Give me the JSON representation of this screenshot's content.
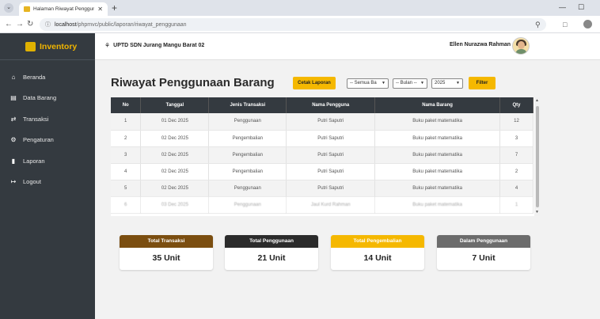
{
  "browser": {
    "tab_title": "Halaman Riwayat Penggunaan",
    "url_host": "localhost",
    "url_path": "/phpmvc/public/laporan/riwayat_penggunaan"
  },
  "sidebar": {
    "brand": "Inventory",
    "items": [
      {
        "label": "Beranda",
        "icon": "home-icon"
      },
      {
        "label": "Data Barang",
        "icon": "list-icon"
      },
      {
        "label": "Transaksi",
        "icon": "exchange-icon"
      },
      {
        "label": "Pengaturan",
        "icon": "gears-icon"
      },
      {
        "label": "Laporan",
        "icon": "file-icon"
      },
      {
        "label": "Logout",
        "icon": "logout-icon"
      }
    ]
  },
  "header": {
    "school": "UPTD SDN Jurang Mangu Barat 02",
    "user": "Ellen Nurazwa Rahman"
  },
  "page": {
    "title": "Riwayat Penggunaan Barang",
    "cetak_label": "Cetak Laporan",
    "filter_type": "-- Semua Ba",
    "filter_month": "-- Bulan --",
    "filter_year": "2025",
    "filter_label": "Filter"
  },
  "table": {
    "headers": [
      "No",
      "Tanggal",
      "Jenis Transaksi",
      "Nama Pengguna",
      "Nama Barang",
      "Qty"
    ],
    "rows": [
      [
        "1",
        "01 Dec 2025",
        "Penggunaan",
        "Putri Saputri",
        "Buku paket matematika",
        "12"
      ],
      [
        "2",
        "02 Dec 2025",
        "Pengembalian",
        "Putri Saputri",
        "Buku paket matematika",
        "3"
      ],
      [
        "3",
        "02 Dec 2025",
        "Pengembalian",
        "Putri Saputri",
        "Buku paket matematika",
        "7"
      ],
      [
        "4",
        "02 Dec 2025",
        "Pengembalian",
        "Putri Saputri",
        "Buku paket matematika",
        "2"
      ],
      [
        "5",
        "02 Dec 2025",
        "Penggunaan",
        "Putri Saputri",
        "Buku paket matematika",
        "4"
      ],
      [
        "6",
        "03 Dec 2025",
        "Penggunaan",
        "Jaul Kurd Rahman",
        "Buku paket matematika",
        "1"
      ]
    ]
  },
  "summary": [
    {
      "label": "Total Transaksi",
      "value": "35 Unit",
      "color": "#7b4e10"
    },
    {
      "label": "Total Penggunaan",
      "value": "21 Unit",
      "color": "#2b2b2b"
    },
    {
      "label": "Total Pengembalian",
      "value": "14 Unit",
      "color": "#f5b800"
    },
    {
      "label": "Dalam Penggunaan",
      "value": "7 Unit",
      "color": "#6c6c6c"
    }
  ]
}
